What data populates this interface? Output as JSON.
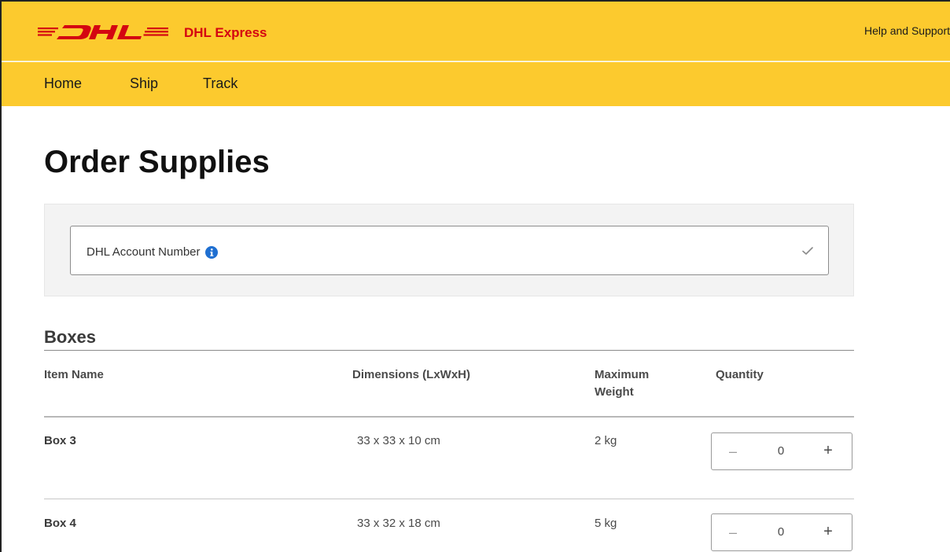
{
  "header": {
    "logo_text": "DHL",
    "brand": "DHL Express",
    "help_link": "Help and Support",
    "logo_color": "#d40511",
    "bar_color": "#fcca2e"
  },
  "nav": {
    "items": [
      {
        "label": "Home"
      },
      {
        "label": "Ship"
      },
      {
        "label": "Track"
      }
    ]
  },
  "page": {
    "title": "Order Supplies"
  },
  "account": {
    "label": "DHL Account Number",
    "info_icon": "info-icon",
    "status_icon": "check-icon"
  },
  "boxes": {
    "section_title": "Boxes",
    "columns": {
      "name": "Item Name",
      "dimensions": "Dimensions (LxWxH)",
      "weight": "Maximum Weight",
      "quantity": "Quantity"
    },
    "rows": [
      {
        "name": "Box 3",
        "dimensions": "33 x 33 x 10 cm",
        "weight": "2 kg",
        "quantity": "0",
        "minus": "–",
        "plus": "+"
      },
      {
        "name": "Box 4",
        "dimensions": "33 x 32 x 18 cm",
        "weight": "5 kg",
        "quantity": "0",
        "minus": "–",
        "plus": "+"
      }
    ]
  }
}
